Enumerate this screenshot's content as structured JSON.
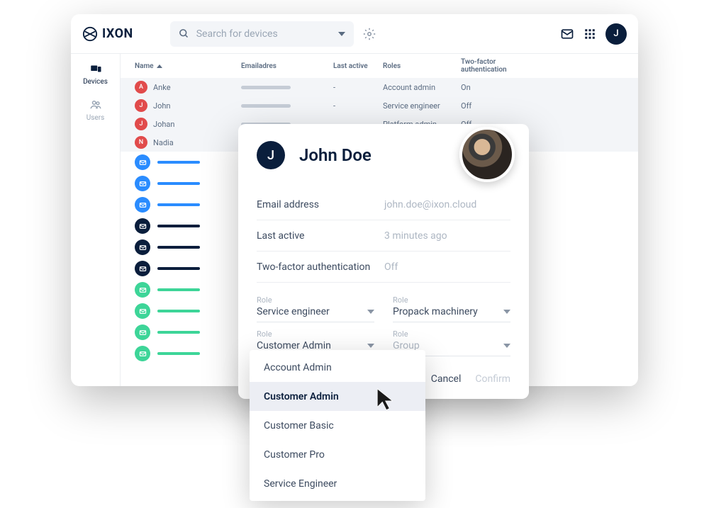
{
  "brand": "IXON",
  "search": {
    "placeholder": "Search for devices"
  },
  "avatar_initial": "J",
  "sidebar": {
    "devices": "Devices",
    "users": "Users"
  },
  "table": {
    "headers": {
      "name": "Name",
      "email": "Emailadres",
      "last_active": "Last active",
      "roles": "Roles",
      "tfa": "Two-factor authentication"
    },
    "rows": [
      {
        "initial": "A",
        "color": "#e14b4b",
        "name": "Anke",
        "last": "-",
        "role": "Account admin",
        "tfa": "On"
      },
      {
        "initial": "J",
        "color": "#e14b4b",
        "name": "John",
        "last": "-",
        "role": "Service engineer",
        "tfa": "Off"
      },
      {
        "initial": "J",
        "color": "#e14b4b",
        "name": "Johan",
        "last": "",
        "role": "Platform admin",
        "tfa": "Off"
      },
      {
        "initial": "N",
        "color": "#e14b4b",
        "name": "Nadia",
        "last": "",
        "role": "",
        "tfa": ""
      }
    ]
  },
  "icon_rows": [
    {
      "bg": "#2a8cff",
      "line": "#2a8cff"
    },
    {
      "bg": "#2a8cff",
      "line": "#2a8cff"
    },
    {
      "bg": "#2a8cff",
      "line": "#2a8cff"
    },
    {
      "bg": "#0a1e3c",
      "line": "#0a1e3c"
    },
    {
      "bg": "#0a1e3c",
      "line": "#0a1e3c"
    },
    {
      "bg": "#0a1e3c",
      "line": "#0a1e3c"
    },
    {
      "bg": "#3dd598",
      "line": "#3dd598"
    },
    {
      "bg": "#3dd598",
      "line": "#3dd598"
    },
    {
      "bg": "#3dd598",
      "line": "#3dd598"
    },
    {
      "bg": "#3dd598",
      "line": "#3dd598"
    }
  ],
  "modal": {
    "initial": "J",
    "name": "John Doe",
    "fields": {
      "email_label": "Email address",
      "email_value": "john.doe@ixon.cloud",
      "last_label": "Last active",
      "last_value": "3 minutes ago",
      "tfa_label": "Two-factor authentication",
      "tfa_value": "Off"
    },
    "selects": {
      "role_label": "Role",
      "role1": "Service engineer",
      "role2": "Propack machinery",
      "role3": "Customer Admin",
      "role4": "Group"
    },
    "cancel": "Cancel",
    "confirm": "Confirm"
  },
  "dropdown": {
    "options": [
      "Account Admin",
      "Customer Admin",
      "Customer Basic",
      "Customer Pro",
      "Service Engineer"
    ],
    "selected_index": 1
  }
}
